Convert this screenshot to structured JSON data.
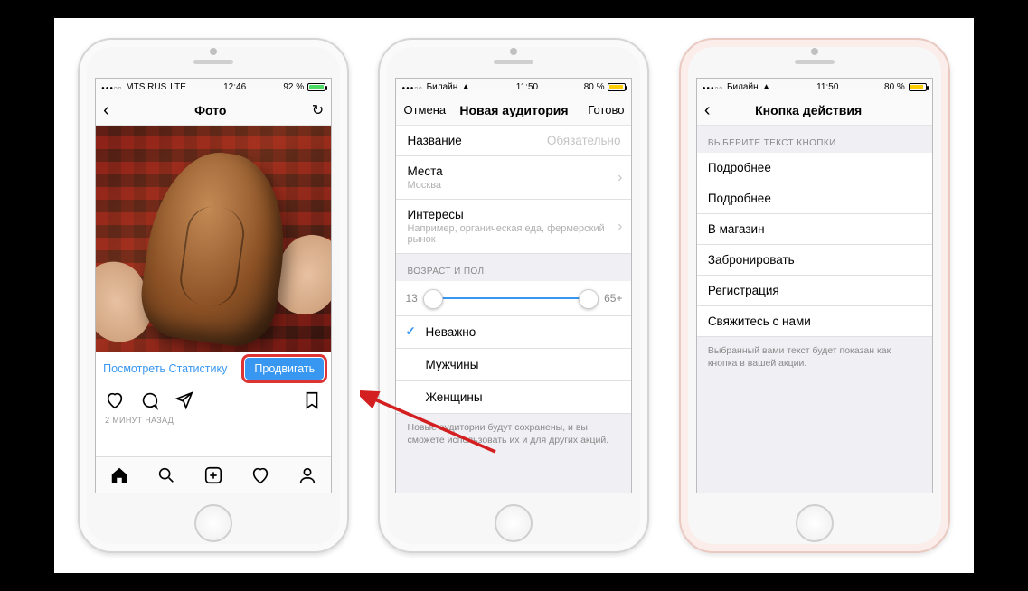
{
  "phone1": {
    "status": {
      "carrier": "MTS RUS",
      "net": "LTE",
      "time": "12:46",
      "battery_pct": "92 %"
    },
    "nav": {
      "title": "Фото"
    },
    "insights_link": "Посмотреть Статистику",
    "promote_button": "Продвигать",
    "timestamp": "2 МИНУТ НАЗАД"
  },
  "phone2": {
    "status": {
      "carrier": "Билайн",
      "time": "11:50",
      "battery_pct": "80 %"
    },
    "nav": {
      "left": "Отмена",
      "title": "Новая аудитория",
      "right": "Готово"
    },
    "name_label": "Название",
    "name_placeholder": "Обязательно",
    "places_label": "Места",
    "places_value": "Москва",
    "interests_label": "Интересы",
    "interests_hint": "Например, органическая еда, фермерский рынок",
    "age_section": "ВОЗРАСТ И ПОЛ",
    "age_min": "13",
    "age_max": "65+",
    "gender_options": {
      "any": "Неважно",
      "male": "Мужчины",
      "female": "Женщины"
    },
    "footer": "Новые аудитории будут сохранены, и вы сможете использовать их и для других акций."
  },
  "phone3": {
    "status": {
      "carrier": "Билайн",
      "time": "11:50",
      "battery_pct": "80 %"
    },
    "nav": {
      "title": "Кнопка действия"
    },
    "section": "ВЫБЕРИТЕ ТЕКСТ КНОПКИ",
    "options": [
      "Подробнее",
      "Подробнее",
      "В магазин",
      "Забронировать",
      "Регистрация",
      "Свяжитесь с нами"
    ],
    "footer": "Выбранный вами текст будет показан как кнопка в вашей акции."
  }
}
